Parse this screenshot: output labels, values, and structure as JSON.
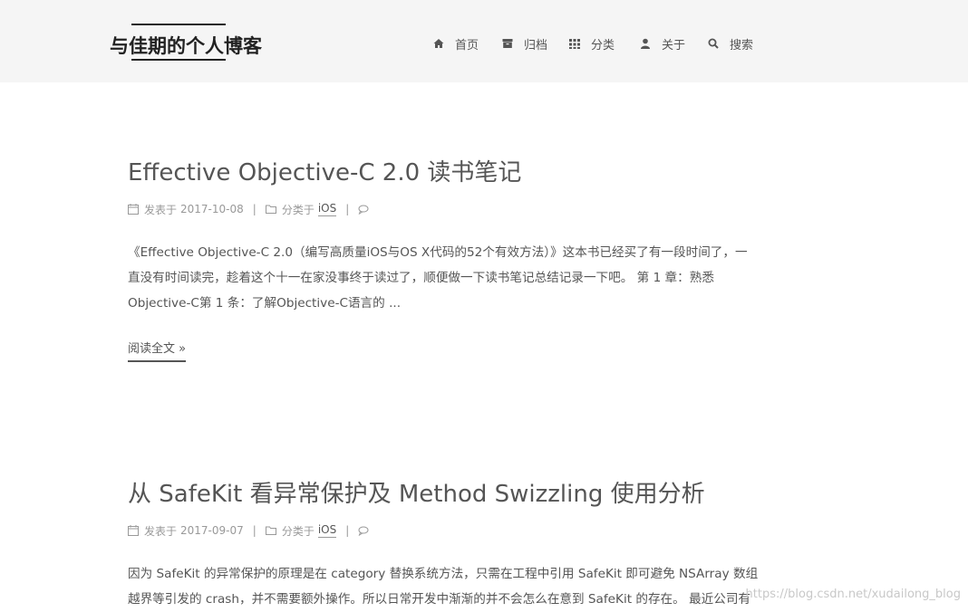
{
  "site": {
    "title": "与佳期的个人博客"
  },
  "nav": [
    {
      "label": "首页",
      "icon": "home-icon"
    },
    {
      "label": "归档",
      "icon": "archive-icon"
    },
    {
      "label": "分类",
      "icon": "grid-icon"
    },
    {
      "label": "关于",
      "icon": "user-icon"
    },
    {
      "label": "搜索",
      "icon": "search-icon"
    }
  ],
  "posts": [
    {
      "title": "Effective Objective-C 2.0 读书笔记",
      "posted_label": "发表于",
      "date": "2017-10-08",
      "category_label": "分类于",
      "category": "iOS",
      "excerpt_lines": [
        "《Effective Objective-C 2.0（编写高质量iOS与OS X代码的52个有效方法）》这本书已经买了有一段时间了，一",
        "直没有时间读完，趁着这个十一在家没事终于读过了，顺便做一下读书笔记总结记录一下吧。 第 1 章：熟悉",
        "Objective-C第 1 条：了解Objective-C语言的 ..."
      ],
      "read_more": "阅读全文 »"
    },
    {
      "title": "从 SafeKit 看异常保护及 Method Swizzling 使用分析",
      "posted_label": "发表于",
      "date": "2017-09-07",
      "category_label": "分类于",
      "category": "iOS",
      "excerpt_lines": [
        "因为 SafeKit 的异常保护的原理是在 category 替换系统方法，只需在工程中引用 SafeKit 即可避免 NSArray 数组",
        "越界等引发的 crash，并不需要额外操作。所以日常开发中渐渐的并不会怎么在意到 SafeKit 的存在。 最近公司有"
      ]
    }
  ],
  "watermark": "https://blog.csdn.net/xudailong_blog"
}
